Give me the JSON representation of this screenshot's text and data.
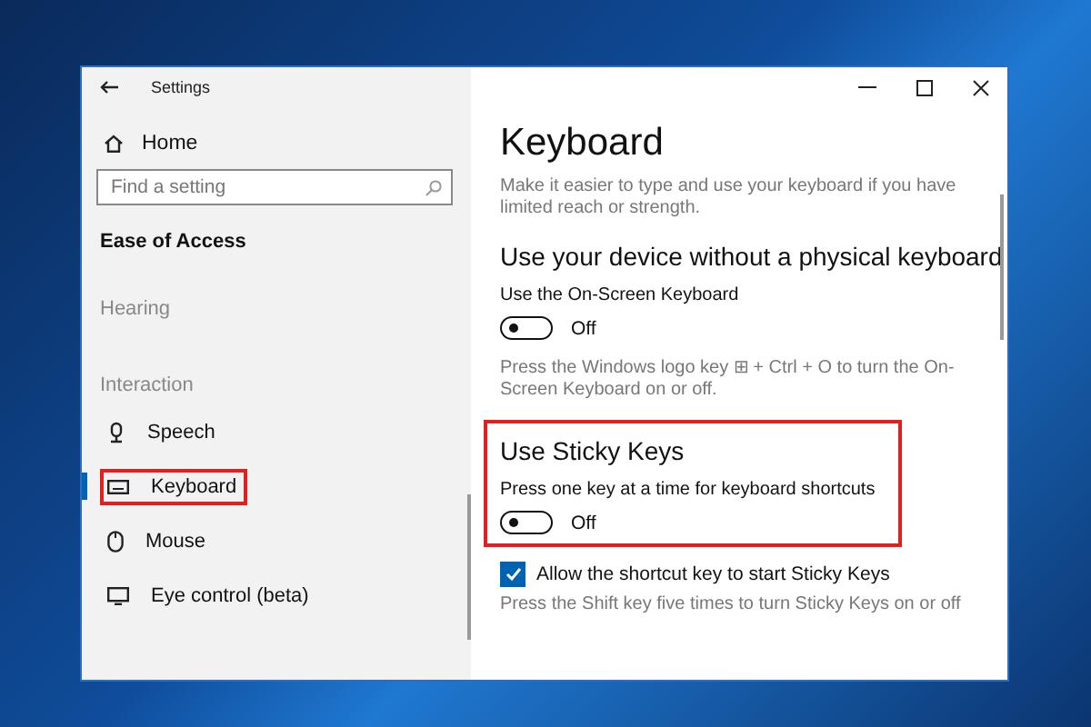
{
  "window": {
    "title": "Settings"
  },
  "sidebar": {
    "home": "Home",
    "search": {
      "placeholder": "Find a setting"
    },
    "section": "Ease of Access",
    "items": [
      {
        "kind": "heading",
        "label": "Hearing"
      },
      {
        "kind": "heading",
        "label": "Interaction"
      },
      {
        "kind": "link",
        "label": "Speech",
        "selected": false,
        "highlighted": false
      },
      {
        "kind": "link",
        "label": "Keyboard",
        "selected": true,
        "highlighted": true
      },
      {
        "kind": "link",
        "label": "Mouse",
        "selected": false,
        "highlighted": false
      },
      {
        "kind": "link",
        "label": "Eye control (beta)",
        "selected": false,
        "highlighted": false
      }
    ]
  },
  "content": {
    "title": "Keyboard",
    "intro": "Make it easier to type and use your keyboard if you have limited reach or strength.",
    "sections": [
      {
        "title": "Use your device without a physical keyboard",
        "label": "Use the On-Screen Keyboard",
        "toggle": {
          "on": false,
          "text": "Off"
        },
        "note": "Press the Windows logo key ⊞ + Ctrl + O to turn the On-Screen Keyboard on or off.",
        "highlighted": false
      },
      {
        "title": "Use Sticky Keys",
        "label": "Press one key at a time for keyboard shortcuts",
        "toggle": {
          "on": false,
          "text": "Off"
        },
        "highlighted": true
      }
    ],
    "checkbox": {
      "label": "Allow the shortcut key to start Sticky Keys",
      "checked": true
    },
    "footnote": "Press the Shift key five times to turn Sticky Keys on or off"
  }
}
